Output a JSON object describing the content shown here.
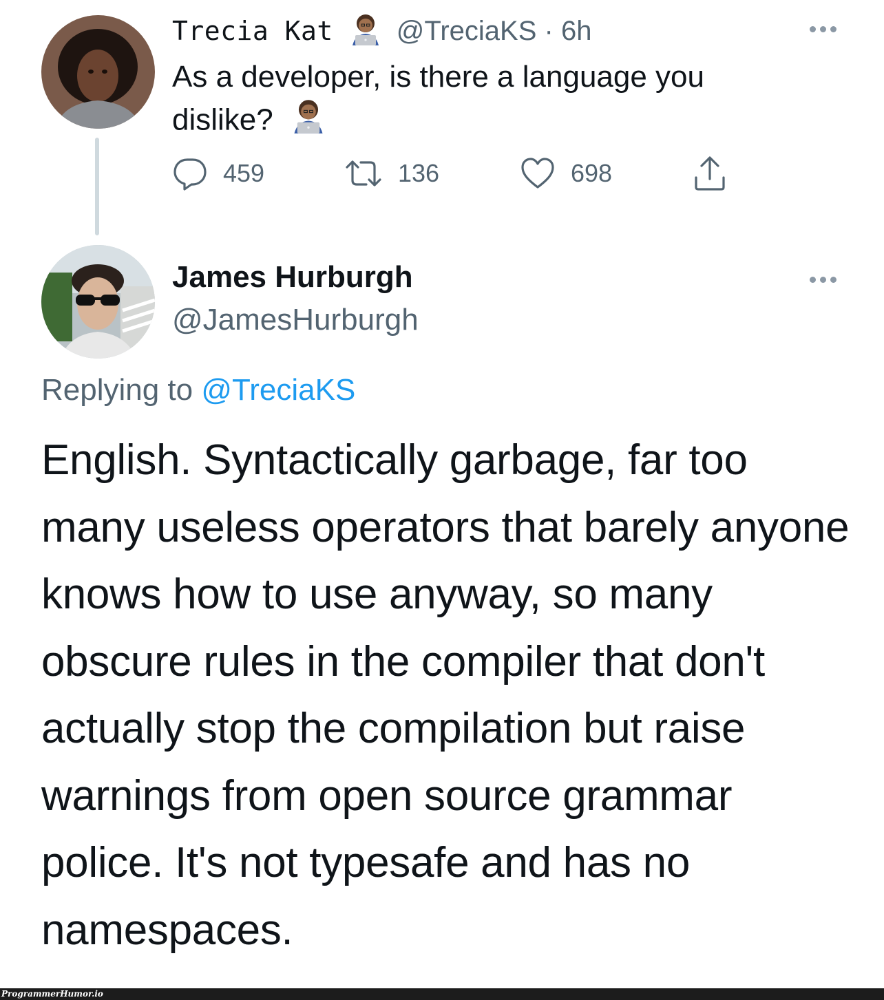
{
  "tweet1": {
    "author": {
      "display_name": "Trecia Kat",
      "name_emoji_icon": "woman-technologist-icon",
      "handle_time": "@TreciaKS · 6h"
    },
    "text": "As a developer, is there a language you dislike?",
    "text_emoji_icon": "woman-technologist-icon",
    "actions": {
      "reply_count": "459",
      "retweet_count": "136",
      "like_count": "698"
    }
  },
  "tweet2": {
    "author": {
      "display_name": "James Hurburgh",
      "handle": "@JamesHurburgh"
    },
    "replying_prefix": "Replying to ",
    "replying_mention": "@TreciaKS",
    "text": "English.  Syntactically garbage, far too many useless operators that barely anyone knows how to use anyway, so many obscure rules in the compiler that don't actually stop the compilation but raise warnings from open source grammar police.  It's not typesafe and has no namespaces."
  },
  "watermark": "ProgrammerHumor.io",
  "colors": {
    "text_primary": "#0f1419",
    "text_secondary": "#536471",
    "accent": "#1d9bf0",
    "thread_line": "#cfd9de"
  }
}
